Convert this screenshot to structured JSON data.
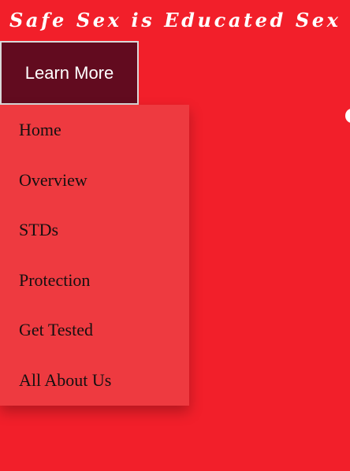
{
  "header": {
    "title": "Safe Sex is Educated Sex"
  },
  "cta": {
    "label": "Learn More"
  },
  "menu": {
    "items": [
      {
        "label": "Home"
      },
      {
        "label": "Overview"
      },
      {
        "label": "STDs"
      },
      {
        "label": "Protection"
      },
      {
        "label": "Get Tested"
      },
      {
        "label": "All About Us"
      }
    ]
  },
  "colors": {
    "page_background": "#f21f2a",
    "button_background": "#620b1f",
    "menu_background": "#ee3a40",
    "title_text": "#ffffff"
  }
}
